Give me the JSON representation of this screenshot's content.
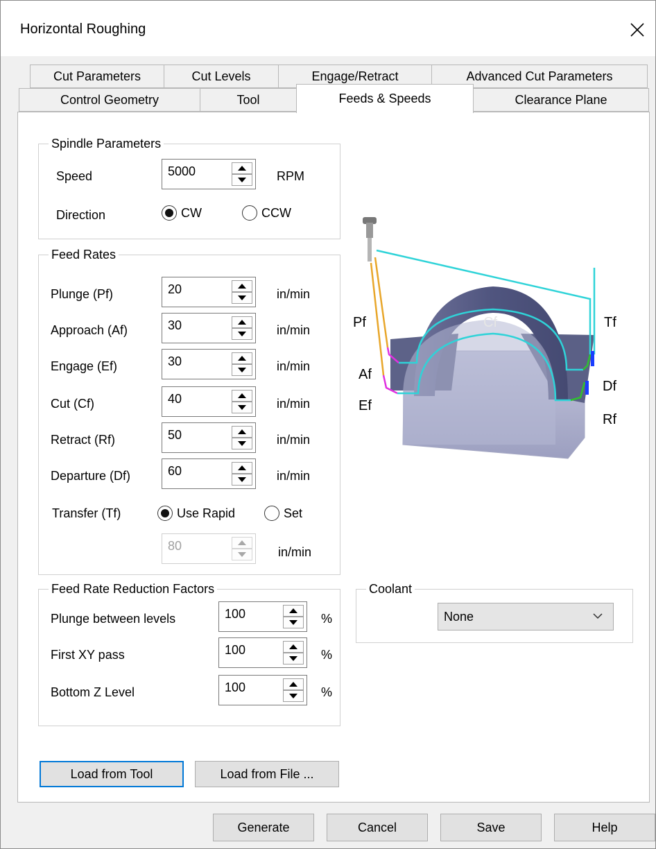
{
  "window": {
    "title": "Horizontal Roughing"
  },
  "tabs_row1": [
    {
      "label": "Cut Parameters"
    },
    {
      "label": "Cut Levels"
    },
    {
      "label": "Engage/Retract"
    },
    {
      "label": "Advanced Cut Parameters"
    }
  ],
  "tabs_row2": [
    {
      "label": "Control Geometry"
    },
    {
      "label": "Tool"
    },
    {
      "label": "Feeds & Speeds",
      "active": true
    },
    {
      "label": "Clearance Plane"
    }
  ],
  "spindle": {
    "title": "Spindle Parameters",
    "speed_label": "Speed",
    "speed_value": "5000",
    "speed_unit": "RPM",
    "direction_label": "Direction",
    "cw_label": "CW",
    "ccw_label": "CCW",
    "direction_selected": "CW"
  },
  "feed_rates": {
    "title": "Feed Rates",
    "rows": [
      {
        "label": "Plunge (Pf)",
        "value": "20",
        "unit": "in/min"
      },
      {
        "label": "Approach (Af)",
        "value": "30",
        "unit": "in/min"
      },
      {
        "label": "Engage (Ef)",
        "value": "30",
        "unit": "in/min"
      },
      {
        "label": "Cut (Cf)",
        "value": "40",
        "unit": "in/min"
      },
      {
        "label": "Retract (Rf)",
        "value": "50",
        "unit": "in/min"
      },
      {
        "label": "Departure  (Df)",
        "value": "60",
        "unit": "in/min"
      }
    ],
    "transfer_label": "Transfer (Tf)",
    "use_rapid_label": "Use Rapid",
    "set_label": "Set",
    "transfer_selected": "Use Rapid",
    "transfer_value": "80",
    "transfer_unit": "in/min"
  },
  "reduction": {
    "title": "Feed Rate Reduction Factors",
    "rows": [
      {
        "label": "Plunge between levels",
        "value": "100",
        "unit": "%"
      },
      {
        "label": "First XY pass",
        "value": "100",
        "unit": "%"
      },
      {
        "label": "Bottom Z Level",
        "value": "100",
        "unit": "%"
      }
    ]
  },
  "coolant": {
    "title": "Coolant",
    "selected": "None"
  },
  "diagram": {
    "labels": {
      "pf": "Pf",
      "af": "Af",
      "ef": "Ef",
      "cf": "Cf",
      "tf": "Tf",
      "df": "Df",
      "rf": "Rf"
    },
    "colors": {
      "cyan": "#2fd3d8",
      "orange": "#e8a62a",
      "magenta": "#e030e0",
      "green": "#30c030",
      "blue": "#1a3cff"
    }
  },
  "buttons": {
    "load_from_tool": "Load from Tool",
    "load_from_file": "Load from File ...",
    "generate": "Generate",
    "cancel": "Cancel",
    "save": "Save",
    "help": "Help"
  }
}
